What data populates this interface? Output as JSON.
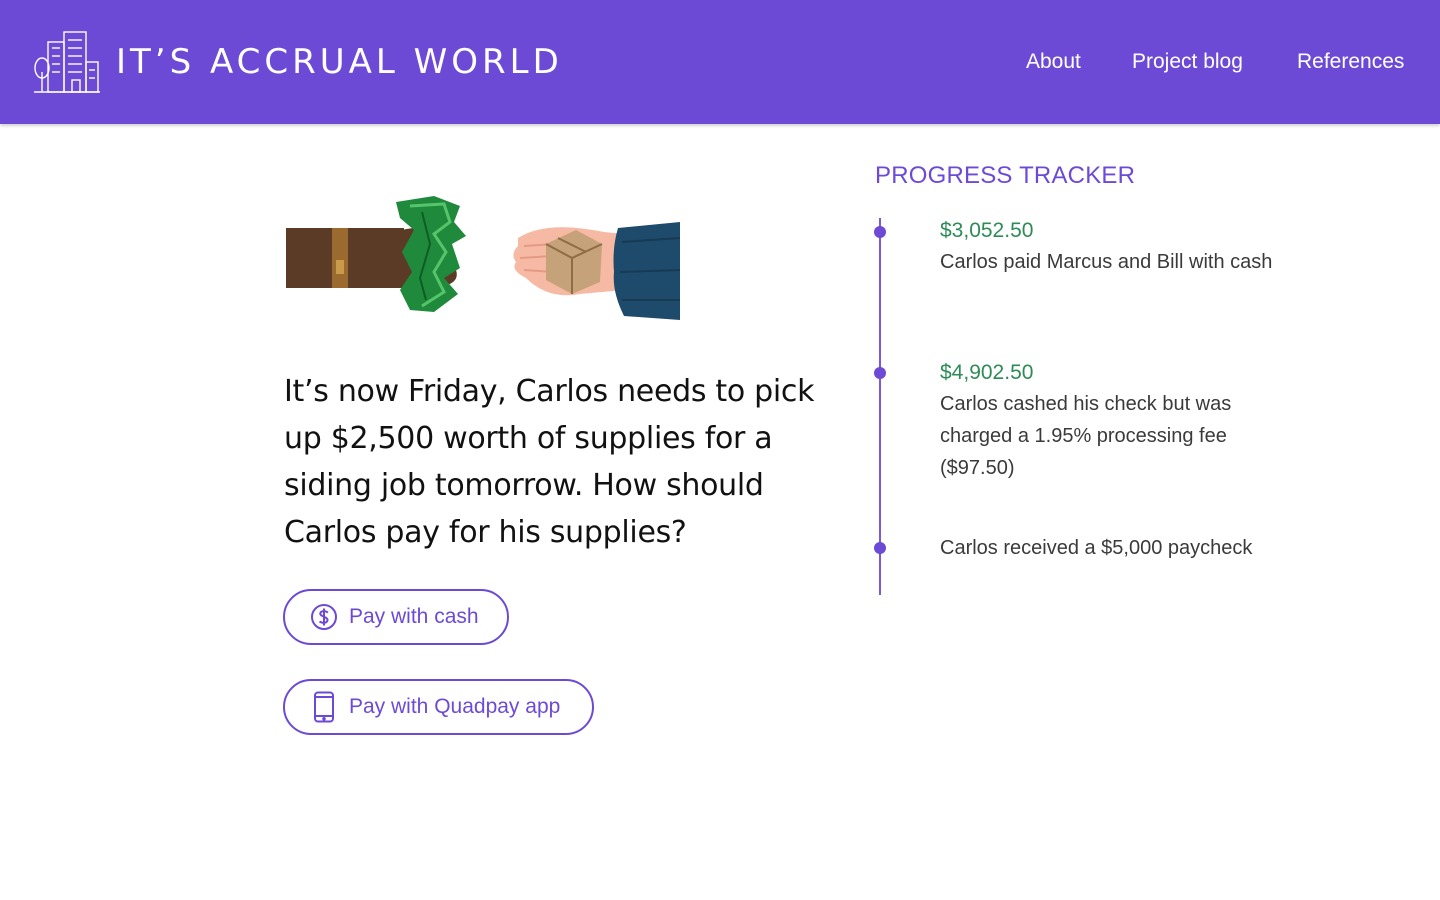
{
  "header": {
    "site_title": "IT’S ACCRUAL WORLD",
    "logo_icon": "city-buildings-icon",
    "nav": {
      "about": "About",
      "blog": "Project blog",
      "references": "References"
    },
    "background_color": "#6d4ad6"
  },
  "main": {
    "illustration": "hand-giving-cash-and-hand-giving-box",
    "question": "It’s now Friday, Carlos needs to pick up $2,500 worth of supplies for a siding job tomorrow. How should Carlos pay for his supplies?",
    "choices": [
      {
        "label": "Pay with cash",
        "icon": "dollar-circle-icon"
      },
      {
        "label": "Pay with Quadpay app",
        "icon": "smartphone-icon"
      }
    ],
    "accent_color": "#6d4ad6"
  },
  "tracker": {
    "title": "PROGRESS TRACKER",
    "entries": [
      {
        "amount": "$3,052.50",
        "description": "Carlos paid Marcus and Bill with cash"
      },
      {
        "amount": "$4,902.50",
        "description": "Carlos cashed his check but was charged a 1.95% processing fee ($97.50)"
      },
      {
        "amount": "",
        "description": "Carlos received a $5,000 paycheck"
      }
    ],
    "amount_color": "#2e8b57"
  }
}
